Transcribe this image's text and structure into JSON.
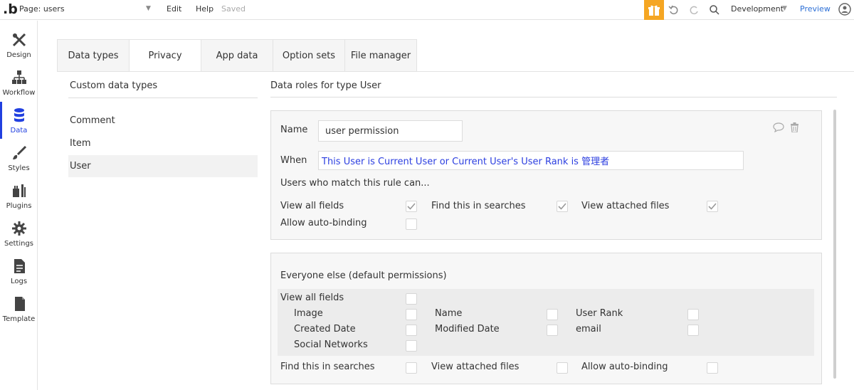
{
  "topbar": {
    "logo": ".b",
    "page_label": "Page: users",
    "menu_edit": "Edit",
    "menu_help": "Help",
    "menu_saved": "Saved",
    "environment": "Development",
    "preview": "Preview"
  },
  "sidebar": {
    "items": [
      {
        "label": "Design"
      },
      {
        "label": "Workflow"
      },
      {
        "label": "Data"
      },
      {
        "label": "Styles"
      },
      {
        "label": "Plugins"
      },
      {
        "label": "Settings"
      },
      {
        "label": "Logs"
      },
      {
        "label": "Template"
      }
    ]
  },
  "tabs": [
    {
      "label": "Data types"
    },
    {
      "label": "Privacy"
    },
    {
      "label": "App data"
    },
    {
      "label": "Option sets"
    },
    {
      "label": "File manager"
    }
  ],
  "types_list": {
    "heading": "Custom data types",
    "items": [
      "Comment",
      "Item",
      "User"
    ]
  },
  "roles": {
    "heading": "Data roles for type User",
    "rule": {
      "name_label": "Name",
      "name_value": "user permission",
      "when_label": "When",
      "when_value": "This User is Current User or Current User's User Rank is 管理者",
      "can_label": "Users who match this rule can...",
      "view_all_fields": "View all fields",
      "find_in_searches": "Find this in searches",
      "view_attached_files": "View attached files",
      "allow_auto_binding": "Allow auto-binding"
    },
    "default": {
      "heading": "Everyone else (default permissions)",
      "view_all_fields": "View all fields",
      "fields": [
        "Image",
        "Name",
        "User Rank",
        "Created Date",
        "Modified Date",
        "email",
        "Social Networks"
      ],
      "find_in_searches": "Find this in searches",
      "view_attached_files": "View attached files",
      "allow_auto_binding": "Allow auto-binding"
    }
  }
}
